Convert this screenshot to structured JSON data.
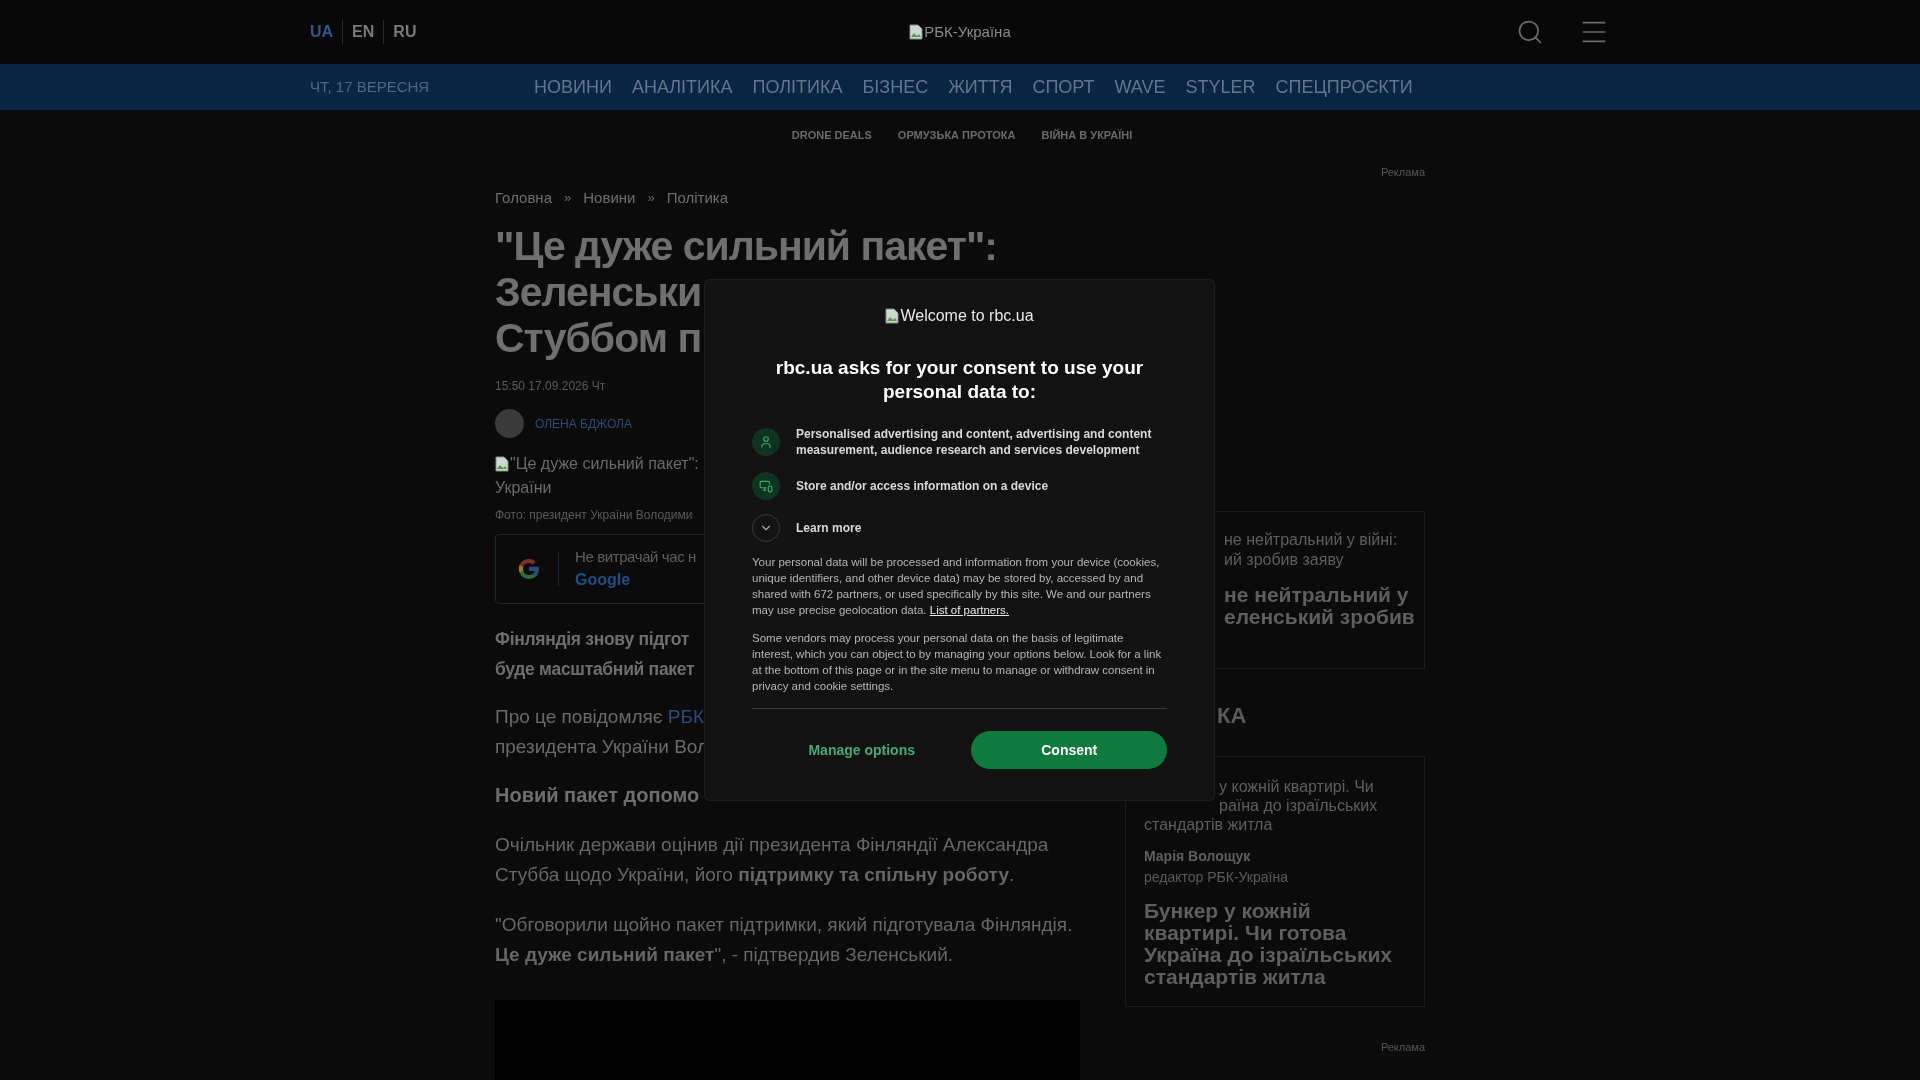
{
  "header": {
    "languages": [
      {
        "label": "UA",
        "selected": true
      },
      {
        "label": "EN",
        "selected": false
      },
      {
        "label": "RU",
        "selected": false
      }
    ],
    "logo_alt": "РБК-Україна"
  },
  "nav": {
    "date": "ЧТ, 17 ВЕРЕСНЯ",
    "items": [
      "НОВИНИ",
      "АНАЛІТИКА",
      "ПОЛІТИКА",
      "БІЗНЕС",
      "ЖИТТЯ",
      "СПОРТ",
      "WAVE",
      "STYLER",
      "СПЕЦПРОЄКТИ"
    ]
  },
  "subnav": [
    "DRONE DEALS",
    "ОРМУЗЬКА ПРОТОКА",
    "ВІЙНА В УКРАЇНІ"
  ],
  "ad_labels": [
    "Реклама",
    "Реклама"
  ],
  "article": {
    "breadcrumbs": [
      {
        "kind": "link",
        "text": "Головна"
      },
      {
        "kind": "separator",
        "text": "»"
      },
      {
        "kind": "link",
        "text": "Новини"
      },
      {
        "kind": "separator",
        "text": "»"
      },
      {
        "kind": "link",
        "text": "Політика"
      }
    ],
    "title_lines": [
      "\"Це дуже сильний пакет\":",
      "Зеленськи",
      "Стуббом п"
    ],
    "date": "15:50 17.09.2026 Чт",
    "author": "ОЛЕНА БДЖОЛА",
    "image_alt_lines": [
      "\"Це дуже сильний пакет\":",
      "України"
    ],
    "caption": "Фото: президент України Володими",
    "promo": {
      "text": "Не витрачай час н",
      "link": "Google"
    },
    "lead_lines": [
      "Фінляндія знову підгот",
      "буде масштабний пакет"
    ],
    "source_line": {
      "text": "Про це повідомляє",
      "link": "РБК"
    },
    "source_line_2": "президента України Вол",
    "subheading": "Новий пакет допомо",
    "paragraphs": [
      "Очільник держави оцінив дії президента Фінляндії Александра Стубба щодо України, його **підтримку та спільну роботу**.",
      "\"Обговорили щойно пакет підтримки, який підготувала Фінляндія. **Це дуже сильний пакет**\", - підтвердив Зеленський."
    ]
  },
  "sidebar": {
    "card_1": {
      "lines": [
        "не нейтральний у війні:",
        "ий зробив заяву"
      ],
      "title_lines": [
        "не нейтральний у",
        "еленський зробив"
      ]
    },
    "section_heading": "КА",
    "card_2": {
      "cut_lines": [
        "у кожній квартирі. Чи",
        "раїна до ізраїльських"
      ],
      "line": "стандартів житла",
      "author": "Марія Волощук",
      "role": "редактор РБК-Україна",
      "title": "Бункер у кожній квартирі. Чи готова Україна до ізраїльських стандартів житла"
    }
  },
  "consent": {
    "logo_alt": "Welcome to rbc.ua",
    "heading": "rbc.ua asks for your consent to use your personal data to:",
    "purposes": [
      {
        "kind": "person",
        "text": "Personalised advertising and content, advertising and content measurement, audience research and services development"
      },
      {
        "kind": "device",
        "text": "Store and/or access information on a device"
      }
    ],
    "learn_more": {
      "label": "Learn more",
      "expanded": false
    },
    "paragraph_1": "Your personal data will be processed and information from your device (cookies, unique identifiers, and other device data) may be stored by, accessed by and shared with 672 partners, or used specifically by this site. We and our partners may use precise geolocation data.",
    "partners_link": "List of partners.",
    "paragraph_2": "Some vendors may process your personal data on the basis of legitimate interest, which you can object to by managing your options below. Look for a link at the bottom of this page or in the site menu to manage or withdraw consent in privacy and cookie settings.",
    "buttons": [
      "Manage options",
      "Consent"
    ]
  }
}
